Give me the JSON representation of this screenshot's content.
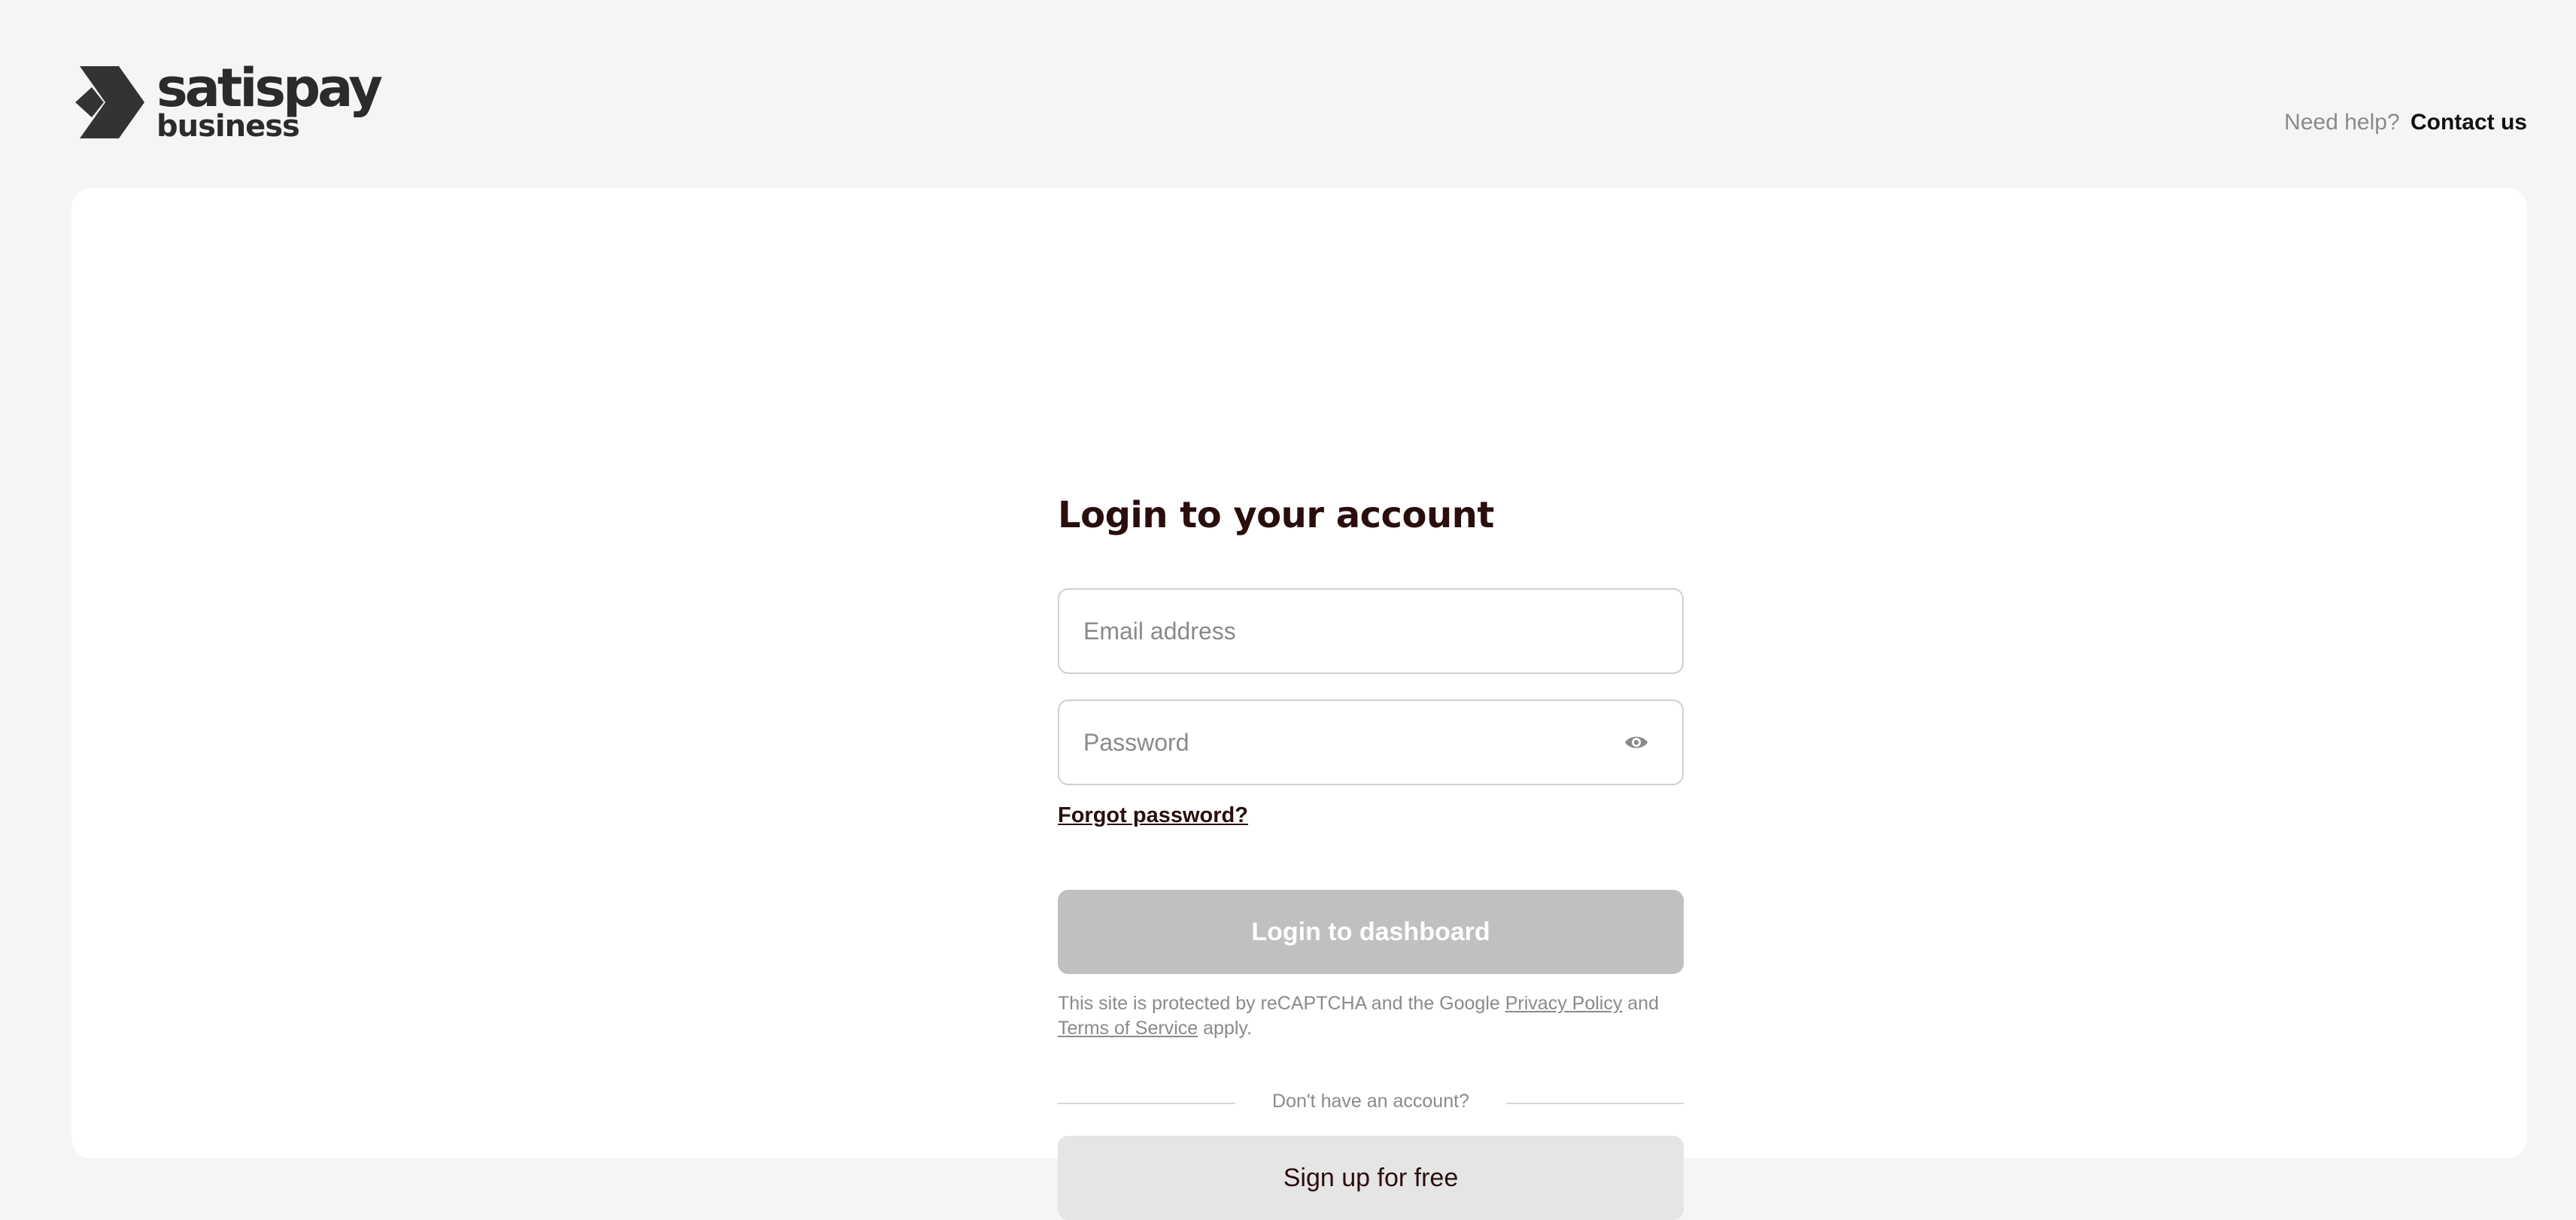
{
  "brand": {
    "name": "satispay",
    "subtitle": "business"
  },
  "header": {
    "help_text": "Need help?",
    "contact_link": "Contact us"
  },
  "login": {
    "title": "Login to your account",
    "email_placeholder": "Email address",
    "password_placeholder": "Password",
    "forgot_password": "Forgot password?",
    "submit_label": "Login to dashboard",
    "recaptcha": {
      "prefix": "This site is protected by reCAPTCHA and the Google",
      "privacy_link": "Privacy Policy",
      "conjunction": "and",
      "terms_link": "Terms of Service",
      "suffix": "apply."
    },
    "divider_text": "Don't have an account?",
    "signup_label": "Sign up for free"
  },
  "colors": {
    "page_background": "#f5f5f5",
    "card_background": "#ffffff",
    "heading_text": "#2a0e0e",
    "disabled_button": "#c0c0c0",
    "secondary_button": "#e5e5e5",
    "muted_text": "#8a8a8a"
  },
  "icons": {
    "logo": "satispay-logo-icon",
    "password_toggle": "eye-icon"
  }
}
